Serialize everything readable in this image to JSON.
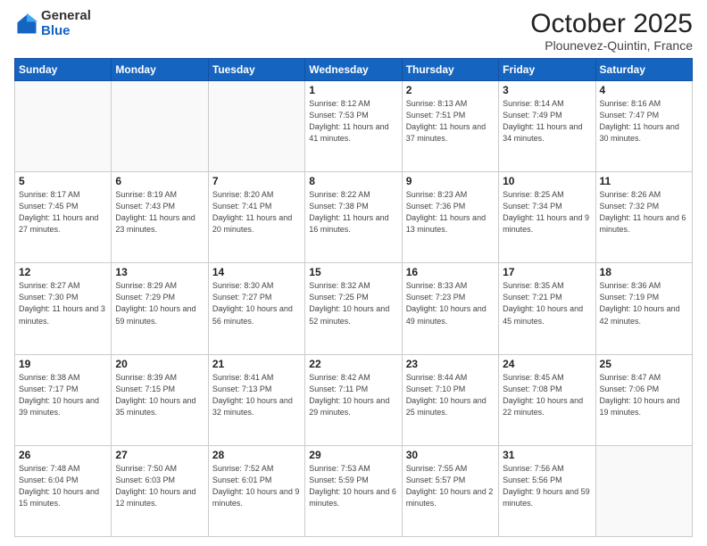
{
  "logo": {
    "general": "General",
    "blue": "Blue"
  },
  "header": {
    "month": "October 2025",
    "location": "Plounevez-Quintin, France"
  },
  "weekdays": [
    "Sunday",
    "Monday",
    "Tuesday",
    "Wednesday",
    "Thursday",
    "Friday",
    "Saturday"
  ],
  "weeks": [
    [
      {
        "day": "",
        "sunrise": "",
        "sunset": "",
        "daylight": ""
      },
      {
        "day": "",
        "sunrise": "",
        "sunset": "",
        "daylight": ""
      },
      {
        "day": "",
        "sunrise": "",
        "sunset": "",
        "daylight": ""
      },
      {
        "day": "1",
        "sunrise": "Sunrise: 8:12 AM",
        "sunset": "Sunset: 7:53 PM",
        "daylight": "Daylight: 11 hours and 41 minutes."
      },
      {
        "day": "2",
        "sunrise": "Sunrise: 8:13 AM",
        "sunset": "Sunset: 7:51 PM",
        "daylight": "Daylight: 11 hours and 37 minutes."
      },
      {
        "day": "3",
        "sunrise": "Sunrise: 8:14 AM",
        "sunset": "Sunset: 7:49 PM",
        "daylight": "Daylight: 11 hours and 34 minutes."
      },
      {
        "day": "4",
        "sunrise": "Sunrise: 8:16 AM",
        "sunset": "Sunset: 7:47 PM",
        "daylight": "Daylight: 11 hours and 30 minutes."
      }
    ],
    [
      {
        "day": "5",
        "sunrise": "Sunrise: 8:17 AM",
        "sunset": "Sunset: 7:45 PM",
        "daylight": "Daylight: 11 hours and 27 minutes."
      },
      {
        "day": "6",
        "sunrise": "Sunrise: 8:19 AM",
        "sunset": "Sunset: 7:43 PM",
        "daylight": "Daylight: 11 hours and 23 minutes."
      },
      {
        "day": "7",
        "sunrise": "Sunrise: 8:20 AM",
        "sunset": "Sunset: 7:41 PM",
        "daylight": "Daylight: 11 hours and 20 minutes."
      },
      {
        "day": "8",
        "sunrise": "Sunrise: 8:22 AM",
        "sunset": "Sunset: 7:38 PM",
        "daylight": "Daylight: 11 hours and 16 minutes."
      },
      {
        "day": "9",
        "sunrise": "Sunrise: 8:23 AM",
        "sunset": "Sunset: 7:36 PM",
        "daylight": "Daylight: 11 hours and 13 minutes."
      },
      {
        "day": "10",
        "sunrise": "Sunrise: 8:25 AM",
        "sunset": "Sunset: 7:34 PM",
        "daylight": "Daylight: 11 hours and 9 minutes."
      },
      {
        "day": "11",
        "sunrise": "Sunrise: 8:26 AM",
        "sunset": "Sunset: 7:32 PM",
        "daylight": "Daylight: 11 hours and 6 minutes."
      }
    ],
    [
      {
        "day": "12",
        "sunrise": "Sunrise: 8:27 AM",
        "sunset": "Sunset: 7:30 PM",
        "daylight": "Daylight: 11 hours and 3 minutes."
      },
      {
        "day": "13",
        "sunrise": "Sunrise: 8:29 AM",
        "sunset": "Sunset: 7:29 PM",
        "daylight": "Daylight: 10 hours and 59 minutes."
      },
      {
        "day": "14",
        "sunrise": "Sunrise: 8:30 AM",
        "sunset": "Sunset: 7:27 PM",
        "daylight": "Daylight: 10 hours and 56 minutes."
      },
      {
        "day": "15",
        "sunrise": "Sunrise: 8:32 AM",
        "sunset": "Sunset: 7:25 PM",
        "daylight": "Daylight: 10 hours and 52 minutes."
      },
      {
        "day": "16",
        "sunrise": "Sunrise: 8:33 AM",
        "sunset": "Sunset: 7:23 PM",
        "daylight": "Daylight: 10 hours and 49 minutes."
      },
      {
        "day": "17",
        "sunrise": "Sunrise: 8:35 AM",
        "sunset": "Sunset: 7:21 PM",
        "daylight": "Daylight: 10 hours and 45 minutes."
      },
      {
        "day": "18",
        "sunrise": "Sunrise: 8:36 AM",
        "sunset": "Sunset: 7:19 PM",
        "daylight": "Daylight: 10 hours and 42 minutes."
      }
    ],
    [
      {
        "day": "19",
        "sunrise": "Sunrise: 8:38 AM",
        "sunset": "Sunset: 7:17 PM",
        "daylight": "Daylight: 10 hours and 39 minutes."
      },
      {
        "day": "20",
        "sunrise": "Sunrise: 8:39 AM",
        "sunset": "Sunset: 7:15 PM",
        "daylight": "Daylight: 10 hours and 35 minutes."
      },
      {
        "day": "21",
        "sunrise": "Sunrise: 8:41 AM",
        "sunset": "Sunset: 7:13 PM",
        "daylight": "Daylight: 10 hours and 32 minutes."
      },
      {
        "day": "22",
        "sunrise": "Sunrise: 8:42 AM",
        "sunset": "Sunset: 7:11 PM",
        "daylight": "Daylight: 10 hours and 29 minutes."
      },
      {
        "day": "23",
        "sunrise": "Sunrise: 8:44 AM",
        "sunset": "Sunset: 7:10 PM",
        "daylight": "Daylight: 10 hours and 25 minutes."
      },
      {
        "day": "24",
        "sunrise": "Sunrise: 8:45 AM",
        "sunset": "Sunset: 7:08 PM",
        "daylight": "Daylight: 10 hours and 22 minutes."
      },
      {
        "day": "25",
        "sunrise": "Sunrise: 8:47 AM",
        "sunset": "Sunset: 7:06 PM",
        "daylight": "Daylight: 10 hours and 19 minutes."
      }
    ],
    [
      {
        "day": "26",
        "sunrise": "Sunrise: 7:48 AM",
        "sunset": "Sunset: 6:04 PM",
        "daylight": "Daylight: 10 hours and 15 minutes."
      },
      {
        "day": "27",
        "sunrise": "Sunrise: 7:50 AM",
        "sunset": "Sunset: 6:03 PM",
        "daylight": "Daylight: 10 hours and 12 minutes."
      },
      {
        "day": "28",
        "sunrise": "Sunrise: 7:52 AM",
        "sunset": "Sunset: 6:01 PM",
        "daylight": "Daylight: 10 hours and 9 minutes."
      },
      {
        "day": "29",
        "sunrise": "Sunrise: 7:53 AM",
        "sunset": "Sunset: 5:59 PM",
        "daylight": "Daylight: 10 hours and 6 minutes."
      },
      {
        "day": "30",
        "sunrise": "Sunrise: 7:55 AM",
        "sunset": "Sunset: 5:57 PM",
        "daylight": "Daylight: 10 hours and 2 minutes."
      },
      {
        "day": "31",
        "sunrise": "Sunrise: 7:56 AM",
        "sunset": "Sunset: 5:56 PM",
        "daylight": "Daylight: 9 hours and 59 minutes."
      },
      {
        "day": "",
        "sunrise": "",
        "sunset": "",
        "daylight": ""
      }
    ]
  ]
}
